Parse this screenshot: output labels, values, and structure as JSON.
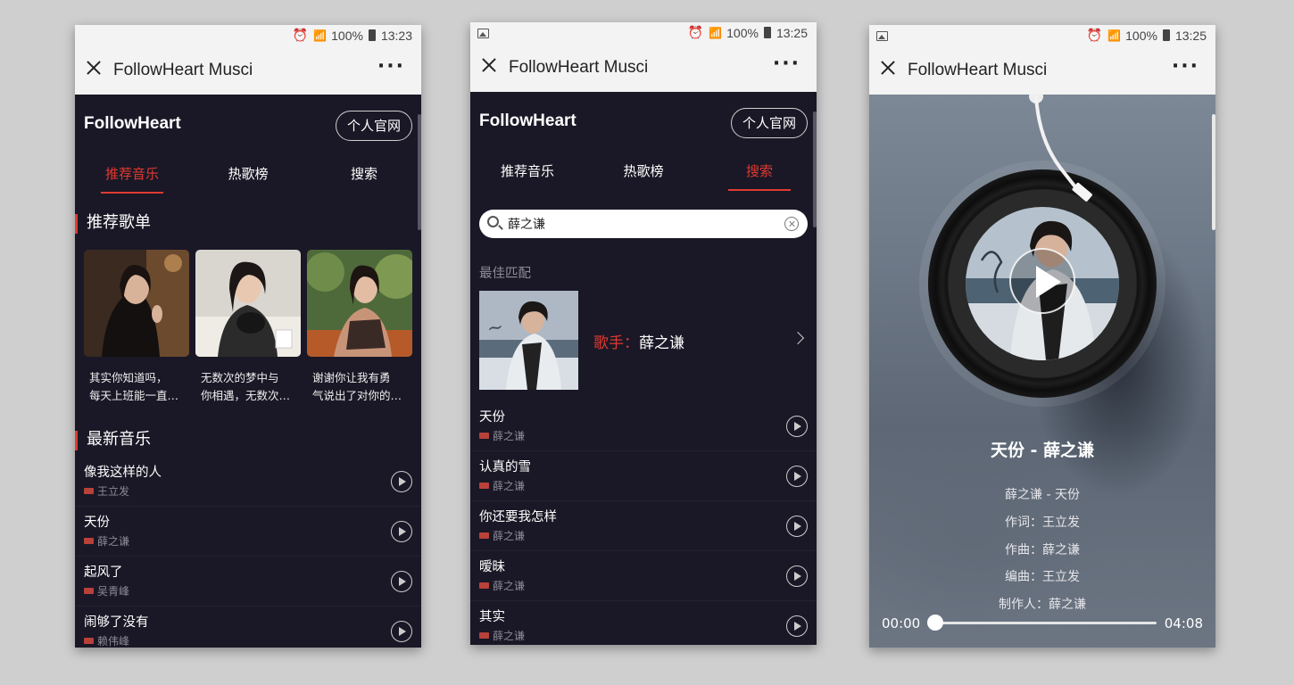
{
  "screens": [
    {
      "status": {
        "battery": "100%",
        "time": "13:23"
      },
      "titlebar": {
        "title": "FollowHeart Musci",
        "more": "···"
      },
      "brand": "FollowHeart",
      "site_button": "个人官网",
      "tabs": [
        "推荐音乐",
        "热歌榜",
        "搜索"
      ],
      "active_tab": "推荐音乐",
      "playlists_heading": "推荐歌单",
      "playlists": [
        {
          "line1": "其实你知道吗，",
          "line2": "每天上班能一直…"
        },
        {
          "line1": "无数次的梦中与",
          "line2": "你相遇，无数次…"
        },
        {
          "line1": "谢谢你让我有勇",
          "line2": "气说出了对你的…"
        }
      ],
      "new_songs_heading": "最新音乐",
      "songs": [
        {
          "title": "像我这样的人",
          "artist": "王立发"
        },
        {
          "title": "天份",
          "artist": "薛之谦"
        },
        {
          "title": "起风了",
          "artist": "吴青峰"
        },
        {
          "title": "闹够了没有",
          "artist": "赖伟峰"
        }
      ]
    },
    {
      "status": {
        "battery": "100%",
        "time": "13:25"
      },
      "titlebar": {
        "title": "FollowHeart Musci",
        "more": "···"
      },
      "brand": "FollowHeart",
      "site_button": "个人官网",
      "tabs": [
        "推荐音乐",
        "热歌榜",
        "搜索"
      ],
      "active_tab": "搜索",
      "search": {
        "value": "薛之谦"
      },
      "best_match_label": "最佳匹配",
      "best_match": {
        "prefix": "歌手：",
        "name": "薛之谦"
      },
      "songs": [
        {
          "title": "天份",
          "artist": "薛之谦"
        },
        {
          "title": "认真的雪",
          "artist": "薛之谦"
        },
        {
          "title": "你还要我怎样",
          "artist": "薛之谦"
        },
        {
          "title": "暧昧",
          "artist": "薛之谦"
        },
        {
          "title": "其实",
          "artist": "薛之谦"
        }
      ]
    },
    {
      "status": {
        "battery": "100%",
        "time": "13:25"
      },
      "titlebar": {
        "title": "FollowHeart Musci",
        "more": "···"
      },
      "song_name": "天份 - 薛之谦",
      "lyrics": [
        "薛之谦 - 天份",
        "作词：王立发",
        "作曲：薛之谦",
        "编曲：王立发",
        "制作人：薛之谦"
      ],
      "time_current": "00:00",
      "time_total": "04:08",
      "progress_fraction": 0
    }
  ],
  "colors": {
    "accent": "#e03a31",
    "background": "#1a1826",
    "titlebar": "#f3f3f3"
  }
}
